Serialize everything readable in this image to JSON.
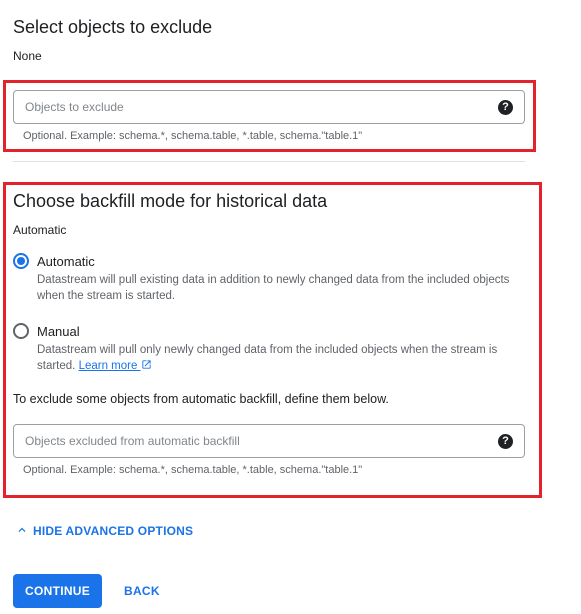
{
  "exclude_section": {
    "title": "Select objects to exclude",
    "value": "None",
    "input_placeholder": "Objects to exclude",
    "hint": "Optional. Example: schema.*, schema.table, *.table, schema.\"table.1\""
  },
  "backfill_section": {
    "title": "Choose backfill mode for historical data",
    "value": "Automatic",
    "options": [
      {
        "label": "Automatic",
        "description": "Datastream will pull existing data in addition to newly changed data from the included objects when the stream is started.",
        "selected": true
      },
      {
        "label": "Manual",
        "description": "Datastream will pull only newly changed data from the included objects when the stream is started.",
        "learn_more": "Learn more",
        "selected": false
      }
    ],
    "exclude_instruction": "To exclude some objects from automatic backfill, define them below.",
    "input_placeholder": "Objects excluded from automatic backfill",
    "hint": "Optional. Example: schema.*, schema.table, *.table, schema.\"table.1\""
  },
  "advanced_toggle": {
    "label": "HIDE ADVANCED OPTIONS",
    "icon": "chevron-up-icon"
  },
  "actions": {
    "continue_label": "CONTINUE",
    "back_label": "BACK"
  },
  "colors": {
    "accent": "#1a73e8",
    "highlight_border": "#e3222b"
  }
}
